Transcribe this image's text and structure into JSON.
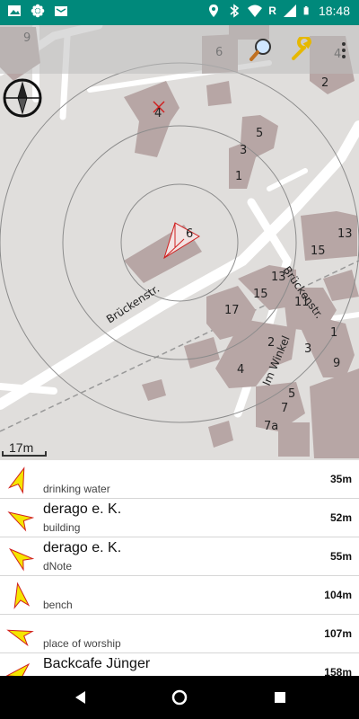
{
  "status_bar": {
    "time": "18:48",
    "network_label": "R",
    "icons": [
      "image-icon",
      "settings-flower-icon",
      "inbox-icon",
      "location-icon",
      "bluetooth-icon",
      "wifi-icon",
      "signal-icon",
      "battery-icon"
    ]
  },
  "map": {
    "street_labels": [
      "Brückenstr.",
      "Brückenstr.",
      "Im Winkel"
    ],
    "house_numbers": [
      "9",
      "6",
      "4",
      "2",
      "4",
      "5",
      "3",
      "1",
      "6",
      "13",
      "15",
      "13",
      "15",
      "11",
      "17",
      "1",
      "2",
      "3",
      "4",
      "9",
      "5",
      "7",
      "7a"
    ],
    "scale_label": "17m",
    "colors": {
      "map_bg": "#e0dedc",
      "building": "#b7a6a5",
      "road": "#ffffff",
      "arrow": "#f5e600",
      "arrow_outline": "#d02020"
    }
  },
  "toolbar": {
    "search_icon": "magnifier-icon",
    "settings_icon": "wrench-icon",
    "menu_icon": "overflow-menu-icon"
  },
  "poi_list": [
    {
      "title": "",
      "subtitle": "drinking water",
      "distance": "35m",
      "bearing": 20
    },
    {
      "title": "derago e. K.",
      "subtitle": "building",
      "distance": "52m",
      "bearing": 300
    },
    {
      "title": "derago e. K.",
      "subtitle": "dNote",
      "distance": "55m",
      "bearing": 310
    },
    {
      "title": "",
      "subtitle": "bench",
      "distance": "104m",
      "bearing": 350
    },
    {
      "title": "",
      "subtitle": "place of worship",
      "distance": "107m",
      "bearing": 290
    },
    {
      "title": "Backcafe Jünger",
      "subtitle": "",
      "distance": "158m",
      "bearing": 45
    }
  ],
  "colors": {
    "status_bar": "#00897b"
  }
}
